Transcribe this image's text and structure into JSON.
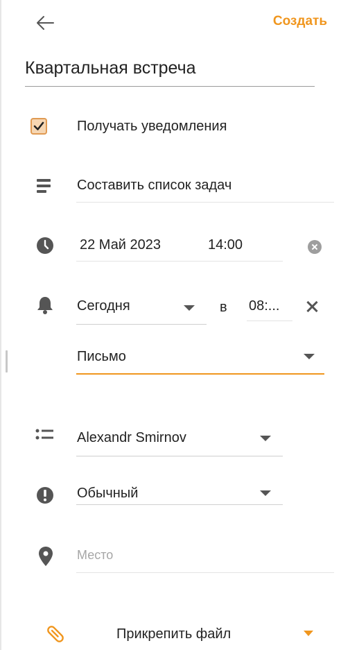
{
  "header": {
    "create_label": "Создать"
  },
  "title": {
    "value": "Квартальная встреча"
  },
  "notifications": {
    "label": "Получать уведомления",
    "checked": true
  },
  "description": {
    "value": "Составить список задач"
  },
  "datetime": {
    "date": "22 Май 2023",
    "time": "14:00"
  },
  "reminder": {
    "day": "Сегодня",
    "at_label": "в",
    "time": "08:...",
    "method": "Письмо"
  },
  "assignee": {
    "value": "Alexandr Smirnov"
  },
  "priority": {
    "value": "Обычный"
  },
  "location": {
    "placeholder": "Место"
  },
  "attach": {
    "label": "Прикрепить файл"
  },
  "colors": {
    "accent": "#f0961e",
    "icon": "#555555",
    "line": "#e3e3e3"
  }
}
